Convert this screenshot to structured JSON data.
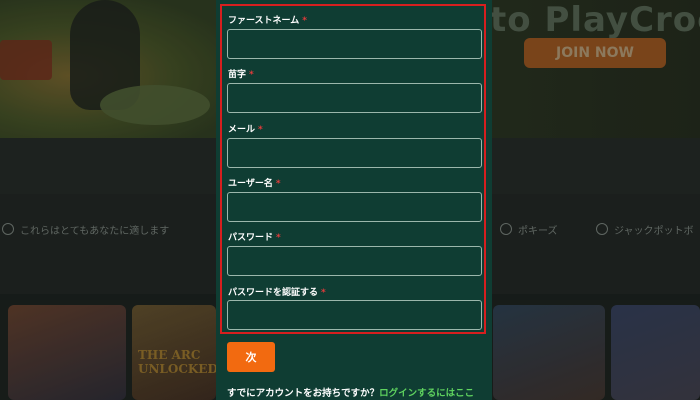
{
  "background": {
    "hero_title": "to PlayCroc",
    "join_button": "JOIN NOW",
    "categories": [
      {
        "label": "これらはとてもあなたに適します",
        "icon": "star-icon"
      },
      {
        "label": "ポキーズ",
        "icon": "slot-icon"
      },
      {
        "label": "ジャックポットボ",
        "icon": "jackpot-icon"
      }
    ],
    "game_tile_text": [
      "THE ARC",
      "UNLOCKED"
    ]
  },
  "form": {
    "fields": [
      {
        "label": "ファーストネーム",
        "required_mark": "*",
        "value": ""
      },
      {
        "label": "苗字",
        "required_mark": "*",
        "value": ""
      },
      {
        "label": "メール",
        "required_mark": "*",
        "value": ""
      },
      {
        "label": "ユーザー名",
        "required_mark": "*",
        "value": ""
      },
      {
        "label": "パスワード",
        "required_mark": "*",
        "value": ""
      },
      {
        "label": "パスワードを認証する",
        "required_mark": "*",
        "value": ""
      }
    ],
    "next_button": "次",
    "footer_prompt": "すでにアカウントをお持ちですか？",
    "login_link": "ログインするにはここ"
  },
  "colors": {
    "modal_bg": "#0f3d33",
    "accent": "#f26a10",
    "highlight_border": "#d61f1f",
    "required": "#e23b3b",
    "link": "#5fd35f"
  }
}
